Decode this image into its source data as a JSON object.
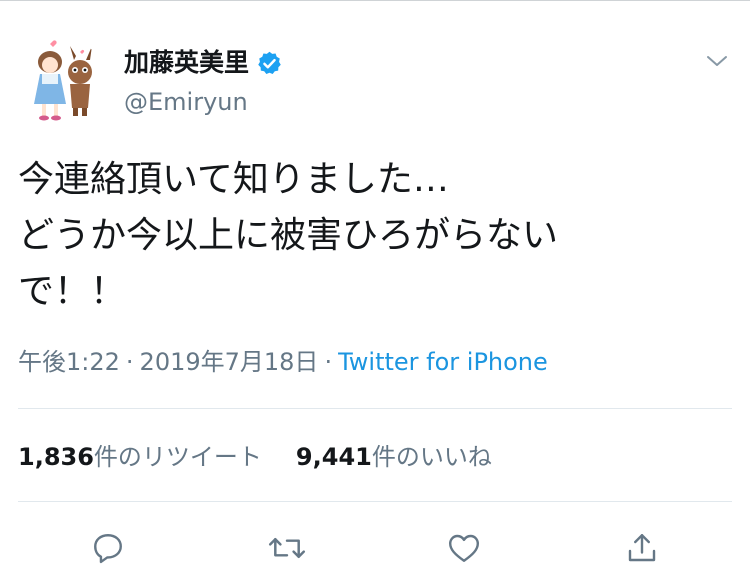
{
  "tweet": {
    "display_name": "加藤英美里",
    "handle": "@Emiryun",
    "verified": true,
    "text_lines": [
      "今連絡頂いて知りました…",
      "どうか今以上に被害ひろがらない",
      "で！！"
    ],
    "time": "午後1:22",
    "date": "2019年7月18日",
    "separator": "·",
    "source": "Twitter for iPhone"
  },
  "stats": {
    "retweets_count": "1,836",
    "retweets_label": "件のリツイート",
    "likes_count": "9,441",
    "likes_label": "件のいいね"
  },
  "colors": {
    "text": "#14171a",
    "secondary": "#657786",
    "link": "#1b95e0",
    "verified": "#1da1f2",
    "divider": "#e1e8ed"
  },
  "icons": {
    "verified": "verified-badge-icon",
    "menu": "chevron-down-icon",
    "reply": "reply-icon",
    "retweet": "retweet-icon",
    "like": "heart-icon",
    "share": "share-icon"
  }
}
